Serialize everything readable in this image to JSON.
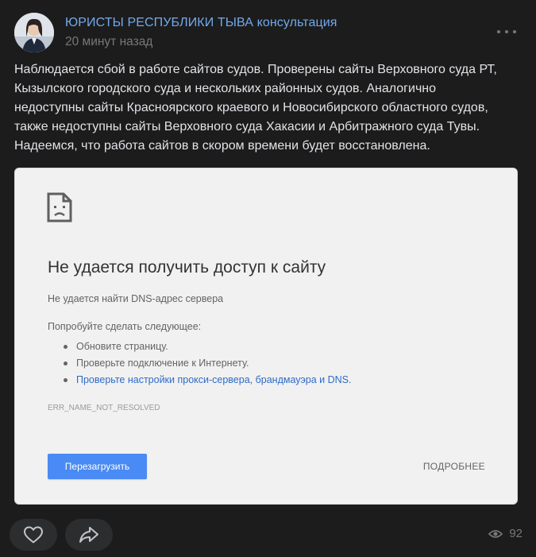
{
  "post": {
    "author": "ЮРИСТЫ РЕСПУБЛИКИ ТЫВА консультация",
    "time": "20 минут назад",
    "text_lines": [
      "Наблюдается сбой в работе сайтов судов. Проверены сайты Верховного суда РТ,",
      "Кызылского городского суда и нескольких районных судов. Аналогично",
      "недоступны сайты Красноярского краевого и Новосибирского областного судов,",
      "также недоступны сайты Верховного суда Хакасии и Арбитражного суда Тувы.",
      "Надеемся, что работа сайтов в скором времени будет восстановлена."
    ]
  },
  "error_page": {
    "icon": "sad-page-icon",
    "title": "Не удается получить доступ к сайту",
    "subtitle": "Не удается найти DNS-адрес сервера",
    "try_label": "Попробуйте сделать следующее:",
    "suggestions": [
      "Обновите страницу.",
      "Проверьте подключение к Интернету.",
      "Проверьте настройки прокси-сервера, брандмауэра и DNS."
    ],
    "error_code": "ERR_NAME_NOT_RESOLVED",
    "reload_label": "Перезагрузить",
    "details_label": "ПОДРОБНЕЕ"
  },
  "footer": {
    "like_icon": "heart-icon",
    "share_icon": "share-icon",
    "views_icon": "eye-icon",
    "views_count": "92"
  },
  "colors": {
    "background": "#1c1c1d",
    "author_link": "#71aaeb",
    "reload_button": "#4a8af4"
  }
}
